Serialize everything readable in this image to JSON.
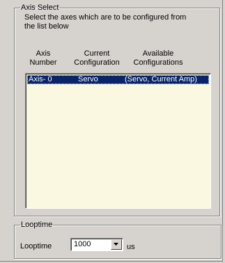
{
  "axis_select": {
    "group_label": "Axis Select",
    "instruction_line1": "Select the axes which are to be configured from",
    "instruction_line2": "the list below",
    "columns": {
      "axis_number_line1": "Axis",
      "axis_number_line2": "Number",
      "current_line1": "Current",
      "current_line2": "Configuration",
      "available_line1": "Available",
      "available_line2": "Configurations"
    },
    "rows": [
      {
        "axis": "Axis- 0",
        "current": "Servo",
        "available": "(Servo, Current Amp)",
        "selected": true
      }
    ]
  },
  "looptime": {
    "group_label": "Looptime",
    "label": "Looptime",
    "value": "1000",
    "unit": "us",
    "dropdown_icon": "chevron-down-icon"
  },
  "colors": {
    "dialog_bg": "#d6d3ce",
    "list_bg": "#faf8e1",
    "selection_bg": "#0a246a",
    "selection_text": "#ffffff"
  }
}
